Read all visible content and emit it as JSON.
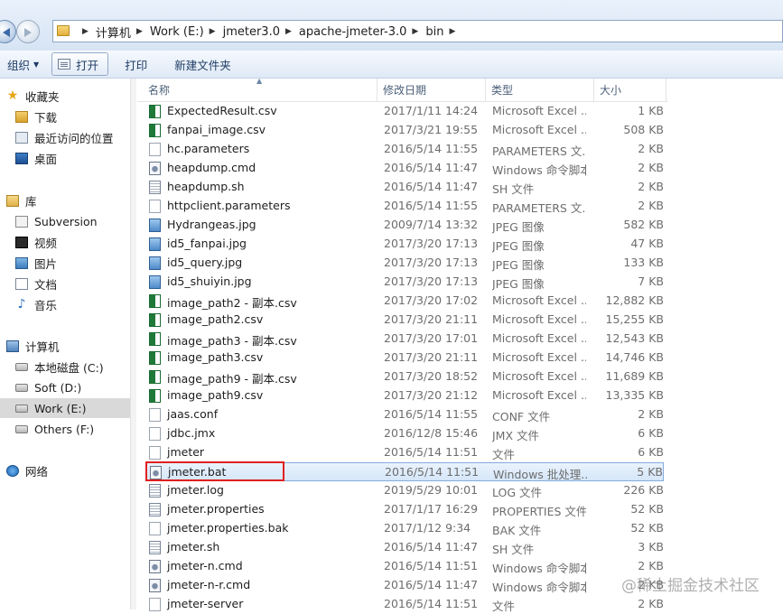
{
  "address": {
    "crumbs": [
      "计算机",
      "Work (E:)",
      "jmeter3.0",
      "apache-jmeter-3.0",
      "bin"
    ]
  },
  "toolbar": {
    "organize_label": "组织",
    "open_label": "打开",
    "print_label": "打印",
    "new_folder_label": "新建文件夹"
  },
  "navpane": {
    "favorites": "收藏夹",
    "favorites_items": [
      "下载",
      "最近访问的位置",
      "桌面"
    ],
    "libraries": "库",
    "libraries_items": [
      "Subversion",
      "视频",
      "图片",
      "文档",
      "音乐"
    ],
    "computer": "计算机",
    "computer_items": [
      "本地磁盘 (C:)",
      "Soft (D:)",
      "Work (E:)",
      "Others (F:)"
    ],
    "network": "网络"
  },
  "columns": {
    "name": "名称",
    "date": "修改日期",
    "type": "类型",
    "size": "大小"
  },
  "files": [
    {
      "name": "ExpectedResult.csv",
      "date": "2017/1/11 14:24",
      "type": "Microsoft Excel ...",
      "size": "1 KB",
      "icon": "excel-icon"
    },
    {
      "name": "fanpai_image.csv",
      "date": "2017/3/21 19:55",
      "type": "Microsoft Excel ...",
      "size": "508 KB",
      "icon": "excel-icon"
    },
    {
      "name": "hc.parameters",
      "date": "2016/5/14 11:55",
      "type": "PARAMETERS 文...",
      "size": "2 KB",
      "icon": "blank-file-icon"
    },
    {
      "name": "heapdump.cmd",
      "date": "2016/5/14 11:47",
      "type": "Windows 命令脚本",
      "size": "2 KB",
      "icon": "gear-file-icon"
    },
    {
      "name": "heapdump.sh",
      "date": "2016/5/14 11:47",
      "type": "SH 文件",
      "size": "2 KB",
      "icon": "text-file-icon"
    },
    {
      "name": "httpclient.parameters",
      "date": "2016/5/14 11:55",
      "type": "PARAMETERS 文...",
      "size": "2 KB",
      "icon": "blank-file-icon"
    },
    {
      "name": "Hydrangeas.jpg",
      "date": "2009/7/14 13:32",
      "type": "JPEG 图像",
      "size": "582 KB",
      "icon": "image-file-icon"
    },
    {
      "name": "id5_fanpai.jpg",
      "date": "2017/3/20 17:13",
      "type": "JPEG 图像",
      "size": "47 KB",
      "icon": "image-file-icon"
    },
    {
      "name": "id5_query.jpg",
      "date": "2017/3/20 17:13",
      "type": "JPEG 图像",
      "size": "133 KB",
      "icon": "image-file-icon"
    },
    {
      "name": "id5_shuiyin.jpg",
      "date": "2017/3/20 17:13",
      "type": "JPEG 图像",
      "size": "7 KB",
      "icon": "image-file-icon"
    },
    {
      "name": "image_path2 - 副本.csv",
      "date": "2017/3/20 17:02",
      "type": "Microsoft Excel ...",
      "size": "12,882 KB",
      "icon": "excel-icon"
    },
    {
      "name": "image_path2.csv",
      "date": "2017/3/20 21:11",
      "type": "Microsoft Excel ...",
      "size": "15,255 KB",
      "icon": "excel-icon"
    },
    {
      "name": "image_path3 - 副本.csv",
      "date": "2017/3/20 17:01",
      "type": "Microsoft Excel ...",
      "size": "12,543 KB",
      "icon": "excel-icon"
    },
    {
      "name": "image_path3.csv",
      "date": "2017/3/20 21:11",
      "type": "Microsoft Excel ...",
      "size": "14,746 KB",
      "icon": "excel-icon"
    },
    {
      "name": "image_path9 - 副本.csv",
      "date": "2017/3/20 18:52",
      "type": "Microsoft Excel ...",
      "size": "11,689 KB",
      "icon": "excel-icon"
    },
    {
      "name": "image_path9.csv",
      "date": "2017/3/20 21:12",
      "type": "Microsoft Excel ...",
      "size": "13,335 KB",
      "icon": "excel-icon"
    },
    {
      "name": "jaas.conf",
      "date": "2016/5/14 11:55",
      "type": "CONF 文件",
      "size": "2 KB",
      "icon": "blank-file-icon"
    },
    {
      "name": "jdbc.jmx",
      "date": "2016/12/8 15:46",
      "type": "JMX 文件",
      "size": "6 KB",
      "icon": "blank-file-icon"
    },
    {
      "name": "jmeter",
      "date": "2016/5/14 11:51",
      "type": "文件",
      "size": "6 KB",
      "icon": "blank-file-icon"
    },
    {
      "name": "jmeter.bat",
      "date": "2016/5/14 11:51",
      "type": "Windows 批处理...",
      "size": "5 KB",
      "icon": "gear-file-icon",
      "selected": true
    },
    {
      "name": "jmeter.log",
      "date": "2019/5/29 10:01",
      "type": "LOG 文件",
      "size": "226 KB",
      "icon": "text-file-icon"
    },
    {
      "name": "jmeter.properties",
      "date": "2017/1/17 16:29",
      "type": "PROPERTIES 文件",
      "size": "52 KB",
      "icon": "text-file-icon"
    },
    {
      "name": "jmeter.properties.bak",
      "date": "2017/1/12 9:34",
      "type": "BAK 文件",
      "size": "52 KB",
      "icon": "blank-file-icon"
    },
    {
      "name": "jmeter.sh",
      "date": "2016/5/14 11:47",
      "type": "SH 文件",
      "size": "3 KB",
      "icon": "text-file-icon"
    },
    {
      "name": "jmeter-n.cmd",
      "date": "2016/5/14 11:51",
      "type": "Windows 命令脚本",
      "size": "2 KB",
      "icon": "gear-file-icon"
    },
    {
      "name": "jmeter-n-r.cmd",
      "date": "2016/5/14 11:47",
      "type": "Windows 命令脚本",
      "size": "2 KB",
      "icon": "gear-file-icon"
    },
    {
      "name": "jmeter-server",
      "date": "2016/5/14 11:51",
      "type": "文件",
      "size": "2 KB",
      "icon": "blank-file-icon"
    }
  ],
  "watermark": "@稀土掘金技术社区",
  "colors": {
    "selection_fill": "#d5e6f9",
    "selection_border": "#84acdd",
    "highlight_box": "#e02020"
  }
}
